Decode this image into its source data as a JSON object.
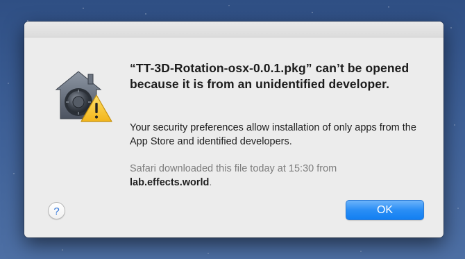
{
  "dialog": {
    "headline": "“TT-3D-Rotation-osx-0.0.1.pkg” can’t be opened because it is from an unidentified developer.",
    "info": "Your security preferences allow installation of only apps from the App Store and identified developers.",
    "source_prefix": "Safari downloaded this file today at 15:30 from ",
    "source_domain": "lab.effects.world",
    "source_suffix": ".",
    "help_label": "?",
    "ok_label": "OK",
    "icon": "gatekeeper-warning-icon"
  },
  "colors": {
    "accent": "#2a8ef5",
    "warning": "#f6c623",
    "dialog_bg": "#ececec",
    "desktop": "#3d5f96"
  }
}
